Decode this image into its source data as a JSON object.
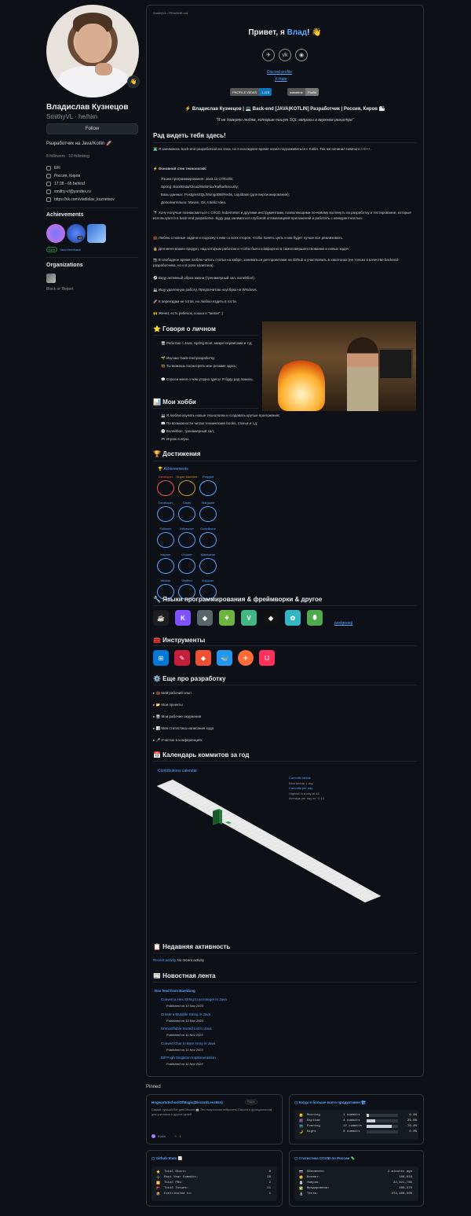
{
  "sidebar": {
    "status_emoji": "👋",
    "name": "Владислав Кузнецов",
    "login": "SmithyVL · he/him",
    "follow_label": "Follow",
    "bio": "Разработчик на Java/Kotlin 🚀",
    "followers": "8 followers · 10 following",
    "meta": [
      {
        "icon": "organization-icon",
        "text": "EFI"
      },
      {
        "icon": "location-icon",
        "text": "Россия, Киров"
      },
      {
        "icon": "clock-icon",
        "text": "17:38 - 6h behind"
      },
      {
        "icon": "mail-icon",
        "text": "smithy-vl@yandex.ru"
      },
      {
        "icon": "link-icon",
        "text": "https://vk.com/vladislav_kuznetsov"
      }
    ],
    "achievements_title": "Achievements",
    "achievement_count": "x2",
    "beta_label": "Beta",
    "send_feedback": "Send feedback",
    "organizations_title": "Organizations",
    "block_report": "Block or Report"
  },
  "readme": {
    "path": "SmithyVL / README.md",
    "hello": "Привет, я ",
    "hello_name": "Влад",
    "hello_end": "! 👋",
    "socials": [
      {
        "icon": "telegram-icon",
        "glyph": "✈"
      },
      {
        "icon": "vk-icon",
        "glyph": "vk"
      },
      {
        "icon": "github-icon",
        "glyph": "◉"
      }
    ],
    "discord_alt": "Discord profile",
    "habr_alt": "X-Habr",
    "views_label": "PROFILE VIEWS",
    "views_value": "1,478",
    "wakatime_label": "wakatime",
    "wakatime_value": "Profile",
    "headline": "⚡ Владислав Кузнецов | 💻 Back-end [JAVA|KOTLIN] Разработчик | Россия, Киров 🏙",
    "quote": "\"Я не доверяю людям, которые пишут SQL-запросы в верхнем регистре\"",
    "welcome_title": "Рад видеть тебя здесь!",
    "intro": "👨‍💻 Я занимаюсь back-end разработкой на Java, но в последнее время начал подсаживаться с Kotlin. Так же начинал немного с С++.",
    "stack_title": "⚡ Основной стек технологий:",
    "stack": [
      "Языки программирования: Java 11-17/Kotlin;",
      "Spring: Boot/Data/Cloud/WebFlux/Kafka/Security;",
      "Базы данных: PostgresSQL/MongoDB/Redis, Liquibase (для версионирования);",
      "Дополнительно: Maven, Git, IntelliJ Idea."
    ],
    "para1": "🔭 Хочу получше познакомиться с CI/CD, kubernetes и другими инструментами, позволяющими по-новому взглянуть на разработку и тестирование, которые используются в back-end разработке. Буду рад заниматься глубокой оптимизацией приложений и работать с конкурентностью.",
    "para2": "💼 Люблю сложные задачи и подхожу к ним со всех сторон, чтобы понять цель и как будет лучше все реализовать.",
    "para3": "🔒 Для меня важен продукт, над которым работаю и чтобы было комфортно в самосовершенствовании и новых задач.",
    "para4": "📷 В свободное время люблю читать статьи на хабре, заниматься pet-проектами на Github и участвовать в хакатонах (не только в качестве backend-разработчика, но и в роли капитана).",
    "para5": "⚽ Веду активный образ жизни (тренажерный зал, волейбол).",
    "para6": "💻 Ищу удаленную работу. Предпочитаю ноутбуки на Windows.",
    "para7": "🚀 К переездам не готов, но люблю ездить в гости.",
    "para8": "🙌 Женат, есть ребенок, кошка и \"вилки\" :)",
    "personal_title": "⭐ Говоря о личном",
    "personal": [
      "🖥 Работаю с Java, Spring Boot, микро-сервисами и т.д;",
      "🌱 Изучаю: back-end разработку;",
      "👯 Ты можешь посмотреть мое резюме здесь;",
      "💬 Спроси меня о чем угодно здесь! Я буду рад помочь."
    ],
    "hobby_title": "📊 Мои хобби",
    "hobbies": [
      "💻 Я люблю изучать новые технологии и создавать крутые приложения;",
      "📖 По возможности читаю технические books, статьи и т.д;",
      "🏐 Волейбол, тренажерный зал;",
      "🎮 Играю в игры."
    ],
    "achievements_title": "🏆 Достижения",
    "trophy_header": "🏆 Achievements",
    "trophies": [
      [
        "Developer",
        "Super Member",
        "Polyglot"
      ],
      [
        "Developer",
        "Gister",
        "Stargazer"
      ],
      [
        "Follower",
        "Influencer",
        "Contributor"
      ],
      [
        "Inspirer",
        "Charter",
        "Maintainer"
      ],
      [
        "Worker",
        "Verified",
        "Explorer"
      ]
    ],
    "lang_title": "🔧 Языки программирования & фреймворки & другое",
    "langs": [
      {
        "icon": "java-icon",
        "glyph": "☕",
        "color": "#1e1e1e"
      },
      {
        "icon": "kotlin-icon",
        "glyph": "K",
        "color": "#7f52ff"
      },
      {
        "icon": "hibernate-icon",
        "glyph": "◆",
        "color": "#59666c"
      },
      {
        "icon": "spring-icon",
        "glyph": "⚘",
        "color": "#6db33f"
      },
      {
        "icon": "vue-icon",
        "glyph": "V",
        "color": "#41b883"
      },
      {
        "icon": "unity-icon",
        "glyph": "◈",
        "color": "#111"
      },
      {
        "icon": "bootstrap-icon",
        "glyph": "✿",
        "color": "#33b6c3"
      },
      {
        "icon": "mongodb-icon",
        "glyph": "⬮",
        "color": "#4fa94d"
      }
    ],
    "postgres_alt": "postgresql",
    "tools_title": "🧰 Инструменты",
    "tools": [
      {
        "icon": "windows-icon",
        "glyph": "⊞",
        "color": "#0078d7"
      },
      {
        "icon": "pencil-icon",
        "glyph": "✎",
        "color": "#c41e3a"
      },
      {
        "icon": "git-icon",
        "glyph": "◆",
        "color": "#f05032"
      },
      {
        "icon": "docker-icon",
        "glyph": "🐳",
        "color": "#2496ed"
      },
      {
        "icon": "postman-icon",
        "glyph": "✈",
        "color": "#ff6c37"
      },
      {
        "icon": "intellij-icon",
        "glyph": "IJ",
        "color": "#fe315d"
      }
    ],
    "more_title": "⚙️ Еще про разработку",
    "details": [
      "▸ 💼 Мой рабочий опыт",
      "▸ 📂 Мои проекты",
      "▸ 🖥 Мои рабочие окружения",
      "▸ 📊 Моя статистика написания кода",
      "▸ 🎤 Участие в конференциях"
    ],
    "calendar_title": "📅 Календарь коммитов за год",
    "calendar_alt": "Contributions calendar",
    "calendar_legend": [
      "Commits streak",
      "Best streak 1 day",
      "Commits per day",
      "Highest in a day at 48",
      "Average per day at ~0.14"
    ],
    "activity_title": "📋 Недавняя активность",
    "activity_text": "No recent activity",
    "activity_link": "Recent activity",
    "news_title": "📰 Новостная лента",
    "news_feed": "Rss feed from Baeldung",
    "news": [
      {
        "title": "Convert a Hex String to an Integer in Java",
        "date": "Published on 12 Nov 2023"
      },
      {
        "title": "Create a Mutable String in Java",
        "date": "Published on 12 Nov 2023"
      },
      {
        "title": "Unmodifiable Sorted List in Java",
        "date": "Published on 11 Nov 2023"
      },
      {
        "title": "Convert Char to Byte Array in Java",
        "date": "Published on 11 Nov 2023"
      },
      {
        "title": "Bill Pugh Singleton Implementation",
        "date": "Published on 11 Nov 2023"
      }
    ]
  },
  "pinned": {
    "title": "Pinned",
    "repo": {
      "name": "HogwartsSchoolOfMagic(DiscordLessBot)",
      "visibility": "Public",
      "desc": "Самый лучший бот для Discord 🤖 Это покупочная нейросеть Discord с функционалом для учеников и других целей",
      "lang": "Kotlin",
      "stars": "1"
    },
    "times": {
      "title": "Когда я больше всего продуктивен 🏗",
      "rows": [
        {
          "emoji": "🌞",
          "name": "Morning",
          "commits": "1 commits",
          "pct": "6.9%",
          "fill": 0.07
        },
        {
          "emoji": "🌆",
          "name": "Daytime",
          "commits": "4 commits",
          "pct": "26.6%",
          "fill": 0.27
        },
        {
          "emoji": "🌃",
          "name": "Evening",
          "commits": "12 commits",
          "pct": "79.4%",
          "fill": 0.79
        },
        {
          "emoji": "🌙",
          "name": "Night",
          "commits": "0 commits",
          "pct": "0.0%",
          "fill": 0.0
        }
      ]
    },
    "stats": {
      "title": "Github Stats 📈",
      "rows": [
        {
          "emoji": "⭐",
          "name": "Total Stars:",
          "value": "8"
        },
        {
          "emoji": "➕",
          "name": "Past Year Commits:",
          "value": "28"
        },
        {
          "emoji": "🔀",
          "name": "Total PRs:",
          "value": "2"
        },
        {
          "emoji": "🚩",
          "name": "Total Issues:",
          "value": "11"
        },
        {
          "emoji": "📦",
          "name": "Contributed to:",
          "value": "1"
        }
      ]
    },
    "covid": {
      "title": "Статистика COVID по России 🦠",
      "rows": [
        {
          "emoji": "🇷🇺",
          "name": "Обновлено",
          "value": "2 minutes ago"
        },
        {
          "emoji": "🤒",
          "name": "Болеют:",
          "value": "108,033"
        },
        {
          "emoji": "💀",
          "name": "Умерло:",
          "value": "22,321,785"
        },
        {
          "emoji": "✅",
          "name": "Выздоровели:",
          "value": "400,370"
        },
        {
          "emoji": "🔬",
          "name": "Тесты:",
          "value": "273,400,000"
        }
      ]
    }
  }
}
